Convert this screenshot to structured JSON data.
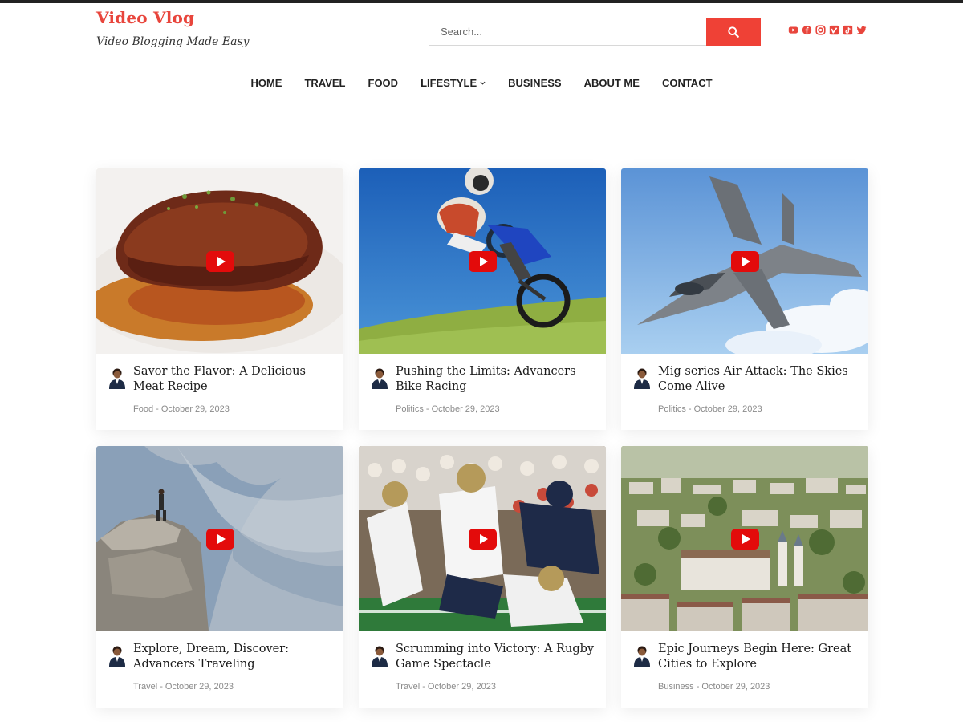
{
  "site": {
    "title": "Video Vlog",
    "tagline": "Video Blogging Made Easy"
  },
  "search": {
    "placeholder": "Search...",
    "button_icon": "search-icon"
  },
  "socials": [
    {
      "icon": "youtube-icon",
      "color": "#e8453c"
    },
    {
      "icon": "facebook-icon",
      "color": "#e8453c"
    },
    {
      "icon": "instagram-icon",
      "color": "#e8453c"
    },
    {
      "icon": "vimeo-icon",
      "color": "#e8453c"
    },
    {
      "icon": "tiktok-icon",
      "color": "#e8453c"
    },
    {
      "icon": "twitter-icon",
      "color": "#e8453c"
    }
  ],
  "nav": {
    "items": [
      "HOME",
      "TRAVEL",
      "FOOD",
      "LIFESTYLE",
      "BUSINESS",
      "ABOUT ME",
      "CONTACT"
    ],
    "dropdown_icon": "chevron-down-icon"
  },
  "posts": [
    {
      "title": "Savor the Flavor: A Delicious Meat Recipe",
      "category": "Food",
      "date": "October 29, 2023",
      "meta": "Food - October 29, 2023",
      "image": "steak-dish"
    },
    {
      "title": "Pushing the Limits: Advancers Bike Racing",
      "category": "Politics",
      "date": "October 29, 2023",
      "meta": "Politics - October 29, 2023",
      "image": "motocross-jump"
    },
    {
      "title": "Mig series Air Attack: The Skies Come Alive",
      "category": "Politics",
      "date": "October 29, 2023",
      "meta": "Politics - October 29, 2023",
      "image": "fighter-jet"
    },
    {
      "title": "Explore, Dream, Discover: Advancers Traveling",
      "category": "Travel",
      "date": "October 29, 2023",
      "meta": "Travel - October 29, 2023",
      "image": "cliff-hiker"
    },
    {
      "title": "Scrumming into Victory: A Rugby Game Spectacle",
      "category": "Travel",
      "date": "October 29, 2023",
      "meta": "Travel - October 29, 2023",
      "image": "football-game"
    },
    {
      "title": "Epic Journeys Begin Here: Great Cities to Explore",
      "category": "Business",
      "date": "October 29, 2023",
      "meta": "Business - October 29, 2023",
      "image": "city-aerial"
    }
  ],
  "colors": {
    "accent": "#ef4136",
    "brand": "#e8453c",
    "play_button": "#e30b0b",
    "text": "#222222",
    "meta": "#8a8a8a"
  }
}
